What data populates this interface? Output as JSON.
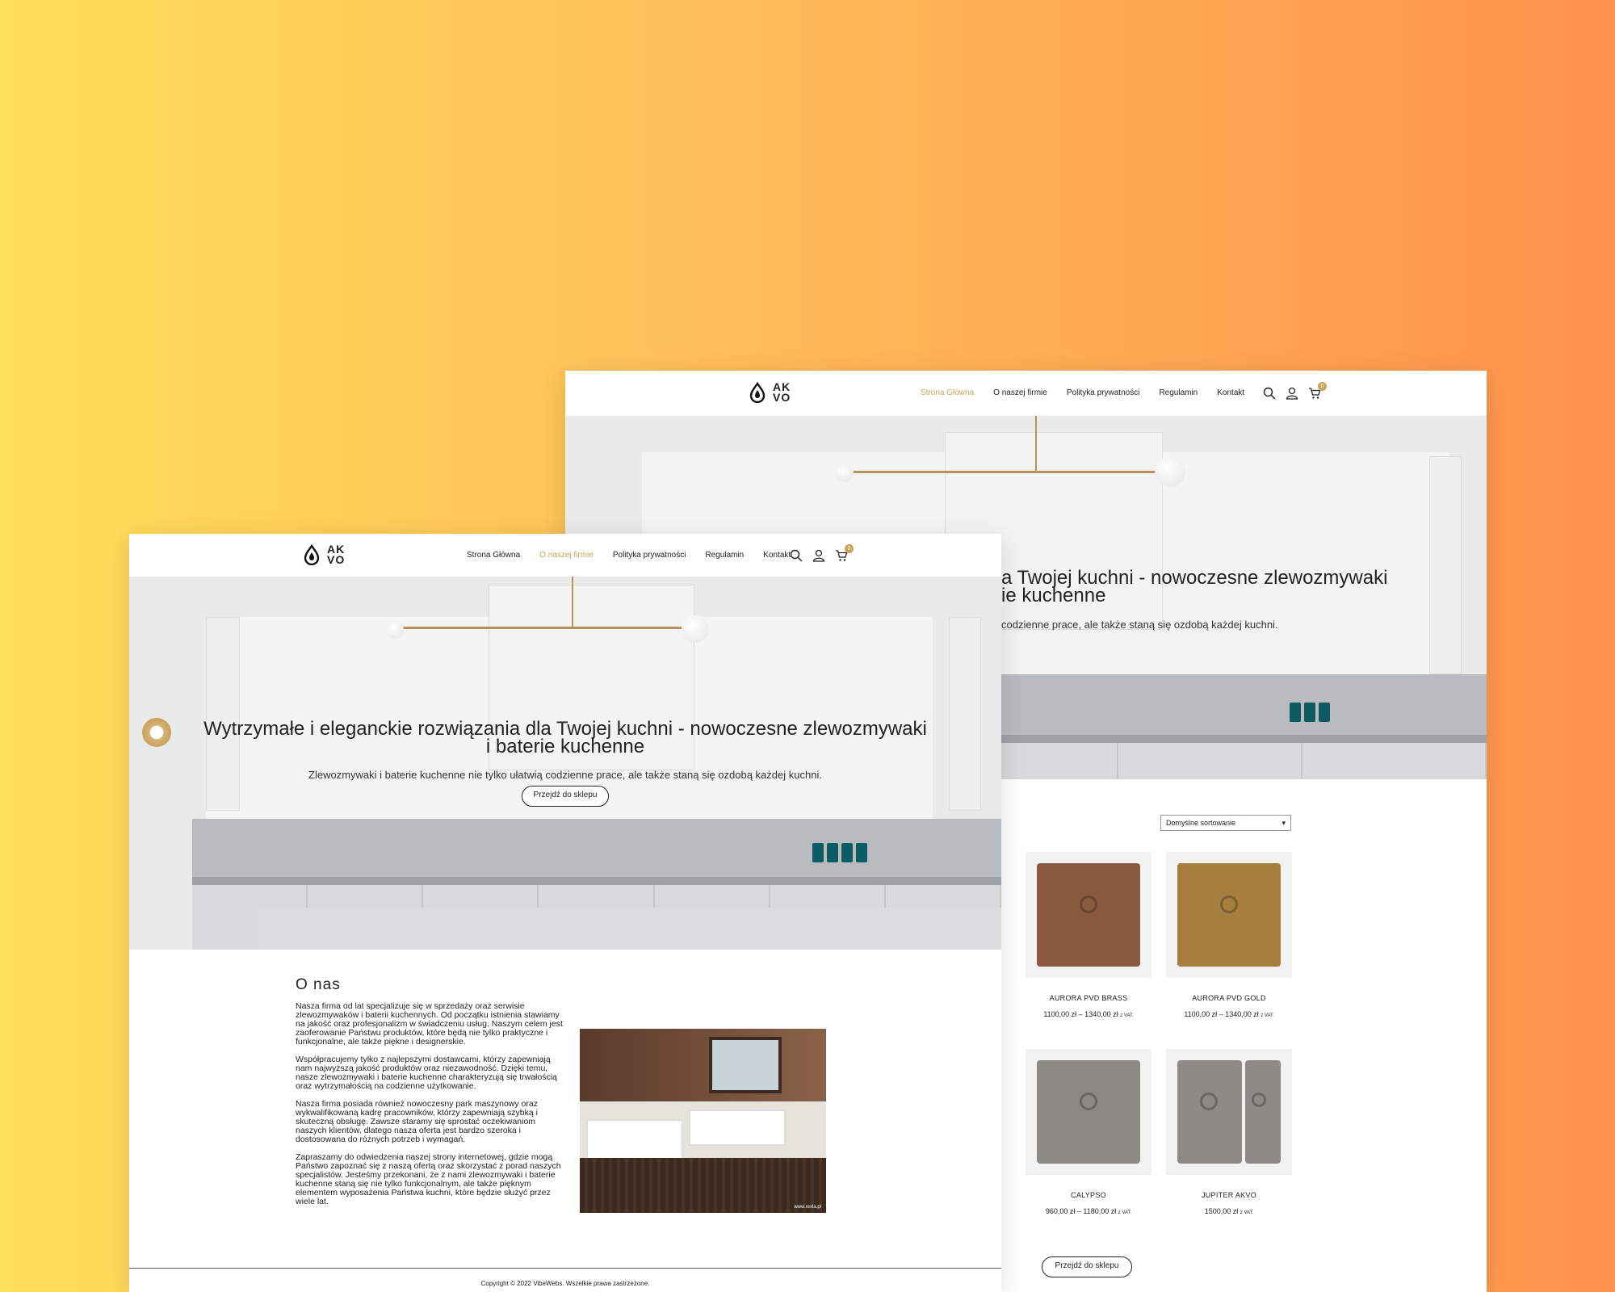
{
  "back": {
    "nav": {
      "home": "Strona Główna",
      "about": "O naszej firmie",
      "privacy": "Polityka prywatności",
      "terms": "Regulamin",
      "contact": "Kontakt"
    },
    "cart_count": "0",
    "hero_title": "a Twojej kuchni - nowoczesne zlewozmywaki ie kuchenne",
    "hero_title_line1": "a Twojej kuchni - nowoczesne zlewozmywaki",
    "hero_title_line2": "ie kuchenne",
    "hero_sub": "codzienne prace, ale także staną się ozdobą każdej kuchni.",
    "sort_select": "Domyślne sortowanie",
    "products": [
      {
        "name": "AURORA PVD BRASS",
        "price": "1100,00 zł – 1340,00 zł",
        "vat": "z VAT.",
        "color": "#8a5a3f"
      },
      {
        "name": "AURORA PVD GOLD",
        "price": "1100,00 zł – 1340,00 zł",
        "vat": "z VAT.",
        "color": "#a67f3f"
      },
      {
        "name": "CALYPSO",
        "price": "960,00 zł – 1180,00 zł",
        "vat": "z VAT.",
        "color": "#8c8a85"
      },
      {
        "name": "JUPITER AKVO",
        "price": "1500,00 zł",
        "vat": "z VAT.",
        "color": "#8e8b86"
      }
    ],
    "shop_button": "Przejdź do sklepu"
  },
  "front": {
    "logo_text_1": "AK",
    "logo_text_2": "VO",
    "nav": {
      "home": "Strona Główna",
      "about": "O naszej firmie",
      "privacy": "Polityka prywatności",
      "terms": "Regulamin",
      "contact": "Kontakt"
    },
    "cart_count": "0",
    "hero_title_line1": "Wytrzymałe i eleganckie rozwiązania dla Twojej kuchni - nowoczesne zlewozmywaki",
    "hero_title_line2": "i baterie kuchenne",
    "hero_sub": "Zlewozmywaki i baterie kuchenne nie tylko ułatwią codzienne prace, ale także staną się ozdobą każdej kuchni.",
    "hero_button": "Przejdź do sklepu",
    "about_heading": "O nas",
    "about_paragraphs": [
      "Nasza firma od lat specjalizuje się w sprzedaży oraz serwisie zlewozmywaków i baterii kuchennych. Od początku istnienia stawiamy na jakość oraz profesjonalizm w świadczeniu usług. Naszym celem jest zaoferowanie Państwu produktów, które będą nie tylko praktyczne i funkcjonalne, ale także piękne i designerskie.",
      "Współpracujemy tylko z najlepszymi dostawcami, którzy zapewniają nam najwyższą jakość produktów oraz niezawodność. Dzięki temu, nasze zlewozmywaki i baterie kuchenne charakteryzują się trwałością oraz wytrzymałością na codzienne użytkowanie.",
      "Nasza firma posiada również nowoczesny park maszynowy oraz wykwalifikowaną kadrę pracowników, którzy zapewniają szybką i skuteczną obsługę. Zawsze staramy się sprostać oczekiwaniom naszych klientów, dlatego nasza oferta jest bardzo szeroka i dostosowana do różnych potrzeb i wymagań.",
      "Zapraszamy do odwiedzenia naszej strony internetowej, gdzie mogą Państwo zapoznać się z naszą ofertą oraz skorzystać z porad naszych specjalistów. Jesteśmy przekonani, że z nami zlewozmywaki i baterie kuchenne staną się nie tylko funkcjonalnym, ale także pięknym elementem wyposażenia Państwa kuchni, które będzie służyć przez wiele lat."
    ],
    "photo_watermark": "www.rexla.pl",
    "copyright": "Copyright © 2022 VibeWebs. Wszelkie prawa zastrzeżone."
  }
}
